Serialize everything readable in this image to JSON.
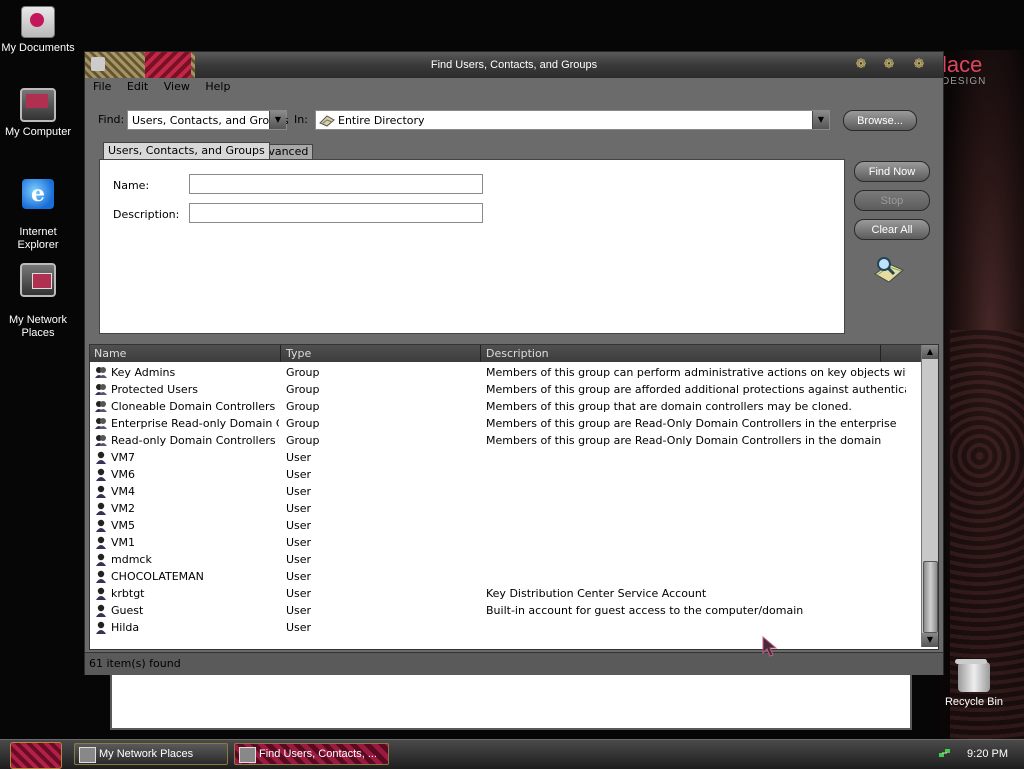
{
  "desktop": {
    "brand_text": "lace",
    "brand_sub": "DESIGN",
    "icons": [
      {
        "label": "My Documents",
        "icon": "my-documents-icon"
      },
      {
        "label": "My Computer",
        "icon": "my-computer-icon"
      },
      {
        "label": "Internet\nExplorer",
        "icon": "internet-explorer-icon"
      },
      {
        "label": "My Network\nPlaces",
        "icon": "network-places-icon"
      },
      {
        "label": "Recycle Bin",
        "icon": "recycle-bin-icon"
      }
    ]
  },
  "window": {
    "title": "Find Users, Contacts, and Groups",
    "menu": [
      "File",
      "Edit",
      "View",
      "Help"
    ],
    "find_label": "Find:",
    "find_value": "Users, Contacts, and Groups",
    "in_label": "In:",
    "in_value": "Entire Directory",
    "browse_label": "Browse...",
    "tabs": [
      "Users, Contacts, and Groups",
      "Advanced"
    ],
    "name_label": "Name:",
    "name_value": "",
    "description_label": "Description:",
    "description_value": "",
    "buttons": {
      "find_now": "Find Now",
      "stop": "Stop",
      "clear_all": "Clear All"
    },
    "columns": [
      "Name",
      "Type",
      "Description"
    ],
    "rows": [
      {
        "name": "Key Admins",
        "type": "Group",
        "description": "Members of this group can perform administrative actions on key objects withi...",
        "icon": "group-icon"
      },
      {
        "name": "Protected Users",
        "type": "Group",
        "description": "Members of this group are afforded additional protections against authenticati...",
        "icon": "group-icon"
      },
      {
        "name": "Cloneable Domain Controllers",
        "type": "Group",
        "description": "Members of this group that are domain controllers may be cloned.",
        "icon": "group-icon"
      },
      {
        "name": "Enterprise Read-only Domain Co...",
        "type": "Group",
        "description": "Members of this group are Read-Only Domain Controllers in the enterprise",
        "icon": "group-icon"
      },
      {
        "name": "Read-only Domain Controllers",
        "type": "Group",
        "description": "Members of this group are Read-Only Domain Controllers in the domain",
        "icon": "group-icon"
      },
      {
        "name": "VM7",
        "type": "User",
        "description": "",
        "icon": "user-icon"
      },
      {
        "name": "VM6",
        "type": "User",
        "description": "",
        "icon": "user-icon"
      },
      {
        "name": "VM4",
        "type": "User",
        "description": "",
        "icon": "user-icon"
      },
      {
        "name": "VM2",
        "type": "User",
        "description": "",
        "icon": "user-icon"
      },
      {
        "name": "VM5",
        "type": "User",
        "description": "",
        "icon": "user-icon"
      },
      {
        "name": "VM1",
        "type": "User",
        "description": "",
        "icon": "user-icon"
      },
      {
        "name": "mdmck",
        "type": "User",
        "description": "",
        "icon": "user-icon"
      },
      {
        "name": "CHOCOLATEMAN",
        "type": "User",
        "description": "",
        "icon": "user-icon"
      },
      {
        "name": "krbtgt",
        "type": "User",
        "description": "Key Distribution Center Service Account",
        "icon": "user-icon"
      },
      {
        "name": "Guest",
        "type": "User",
        "description": "Built-in account for guest access to the computer/domain",
        "icon": "user-icon"
      },
      {
        "name": "Hilda",
        "type": "User",
        "description": "",
        "icon": "user-icon"
      }
    ],
    "status": "61 item(s) found"
  },
  "taskbar": {
    "tasks": [
      {
        "label": "My Network Places",
        "active": false
      },
      {
        "label": "Find Users, Contacts, ...",
        "active": true
      }
    ],
    "clock": "9:20 PM"
  }
}
